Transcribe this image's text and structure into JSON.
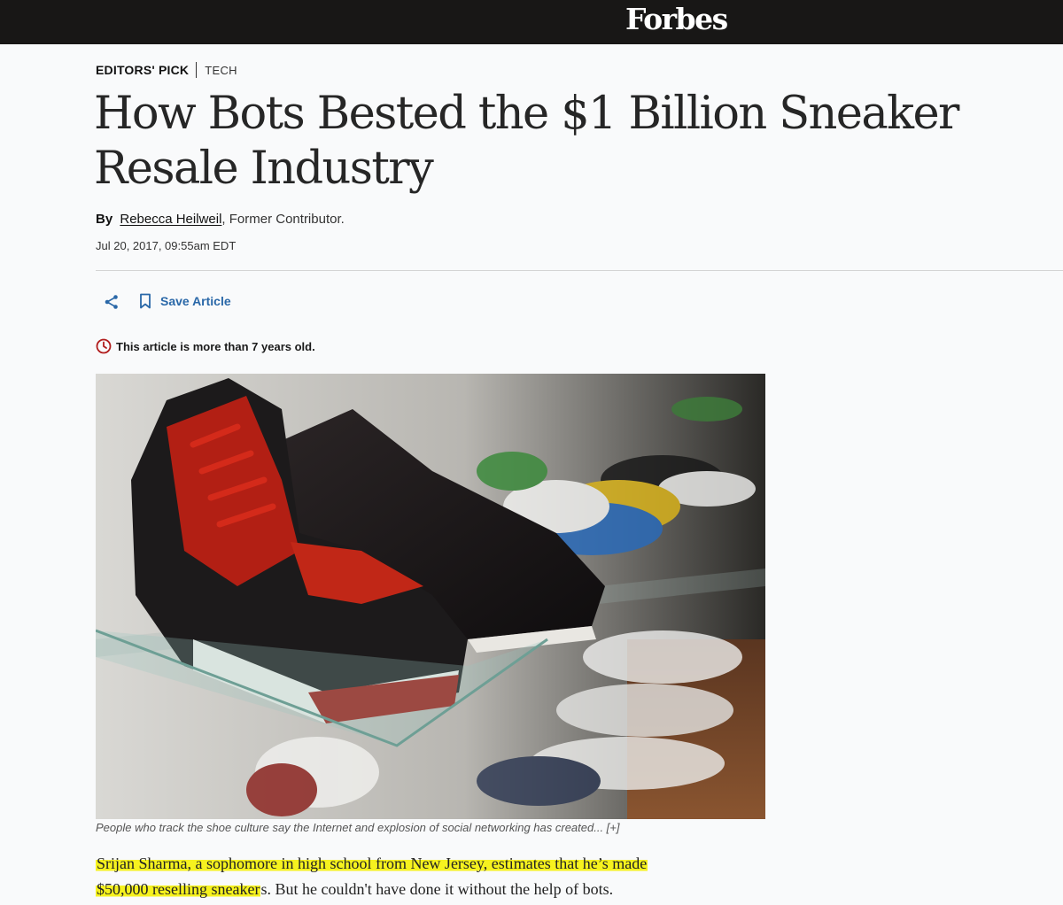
{
  "header": {
    "logo": "Forbes"
  },
  "kicker": {
    "pick": "EDITORS' PICK",
    "section": "TECH"
  },
  "article": {
    "headline": "How Bots Bested the $1 Billion Sneaker Resale Industry",
    "by": "By",
    "author": "Rebecca Heilweil",
    "author_role": ", Former Contributor.",
    "date": "Jul 20, 2017, 09:55am EDT",
    "save_label": "Save Article",
    "age_notice": "This article is more than 7 years old.",
    "caption": "People who track the shoe culture say the Internet and explosion of social networking has created... [+]",
    "body": {
      "highlighted_1": "Srijan Sharma, a sophomore in high school from New Jersey, estimates that he’s made",
      "highlighted_2": "$50,000 reselling sneaker",
      "rest": "s. But he couldn't have done it without the help of bots."
    }
  },
  "colors": {
    "topbar": "#181716",
    "accent_blue": "#2a68a8",
    "warning_red": "#b11d1d",
    "highlight": "#f6f21f"
  },
  "icons": {
    "share": "share-icon",
    "save": "bookmark-icon",
    "age": "clock-icon"
  }
}
